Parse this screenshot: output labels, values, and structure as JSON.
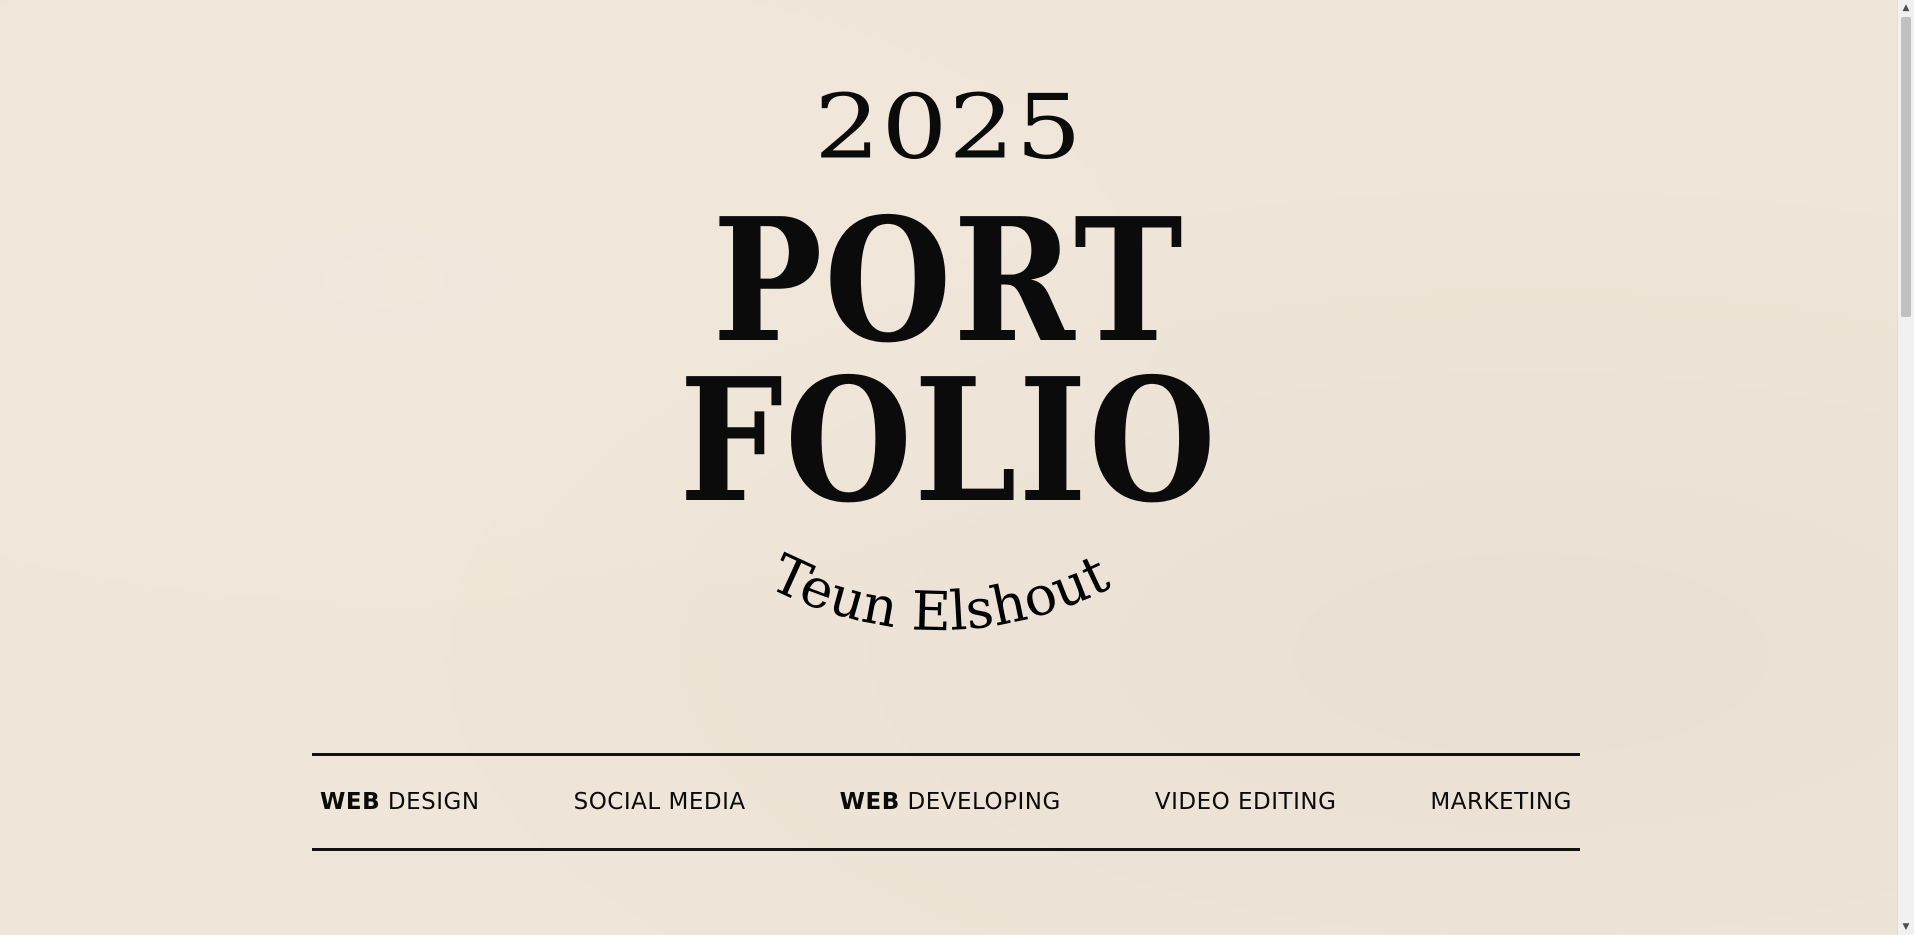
{
  "hero": {
    "year": "2025",
    "title_line_1": "PORT",
    "title_line_2": "FOLIO",
    "name": "Teun Elshout"
  },
  "skills": [
    {
      "strong": "WEB",
      "rest": " DESIGN"
    },
    {
      "strong": "",
      "rest": "SOCIAL MEDIA"
    },
    {
      "strong": "WEB",
      "rest": " DEVELOPING"
    },
    {
      "strong": "",
      "rest": "VIDEO EDITING"
    },
    {
      "strong": "",
      "rest": "MARKETING"
    }
  ],
  "colors": {
    "background": "#efe5d8",
    "text": "#0b0b0b"
  },
  "scrollbar": {
    "up_icon": "scroll-up-arrow-icon",
    "down_icon": "scroll-down-arrow-icon"
  }
}
